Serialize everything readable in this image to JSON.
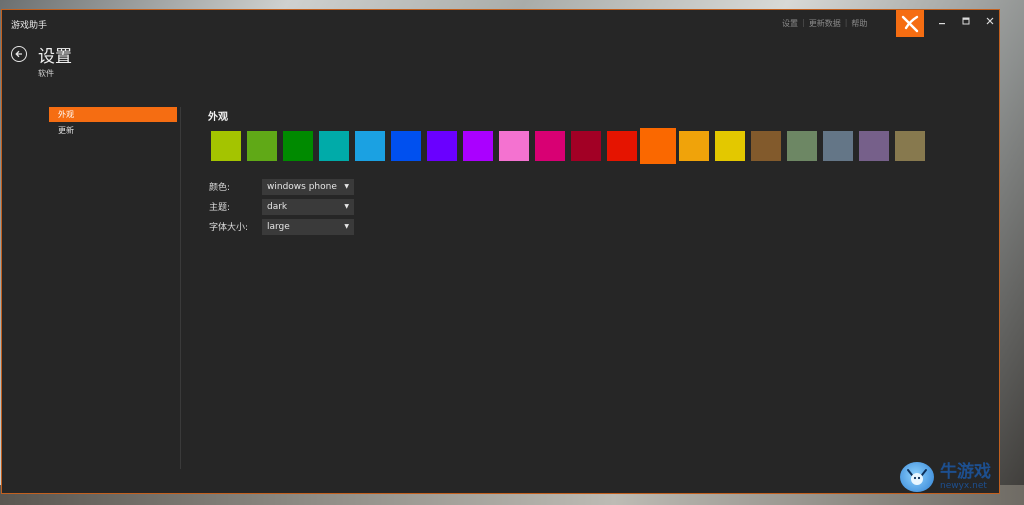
{
  "app": {
    "title": "游戏助手",
    "top_links": [
      "设置",
      "更新数据",
      "帮助"
    ]
  },
  "icons": {
    "back": "back-arrow-circle-icon",
    "logo": "x-logo-icon",
    "minimize": "minimize-icon",
    "maximize": "maximize-icon",
    "close": "close-icon",
    "dropdown": "caret-down-icon"
  },
  "header": {
    "title": "设置",
    "subtitle": "软件"
  },
  "sidebar": {
    "items": [
      {
        "label": "外观",
        "active": true
      },
      {
        "label": "更新",
        "active": false
      }
    ]
  },
  "appearance": {
    "section_title": "外观",
    "accent_colors": [
      "#a4c400",
      "#60a917",
      "#008a00",
      "#00aba9",
      "#1ba1e2",
      "#0050ef",
      "#6a00ff",
      "#aa00ff",
      "#f472d0",
      "#d80073",
      "#a20025",
      "#e51400",
      "#fa6800",
      "#f0a30a",
      "#e3c800",
      "#825a2c",
      "#6d8764",
      "#647687",
      "#76608a",
      "#87794e"
    ],
    "selected_color_index": 12,
    "settings": [
      {
        "label": "颜色:",
        "value": "windows phone"
      },
      {
        "label": "主题:",
        "value": "dark"
      },
      {
        "label": "字体大小:",
        "value": "large"
      }
    ]
  },
  "watermark": {
    "cn": "牛游戏",
    "en": "newyx.net"
  },
  "colors": {
    "accent": "#f56d12",
    "background": "#262626",
    "dropdown_bg": "#3a3a3a"
  }
}
